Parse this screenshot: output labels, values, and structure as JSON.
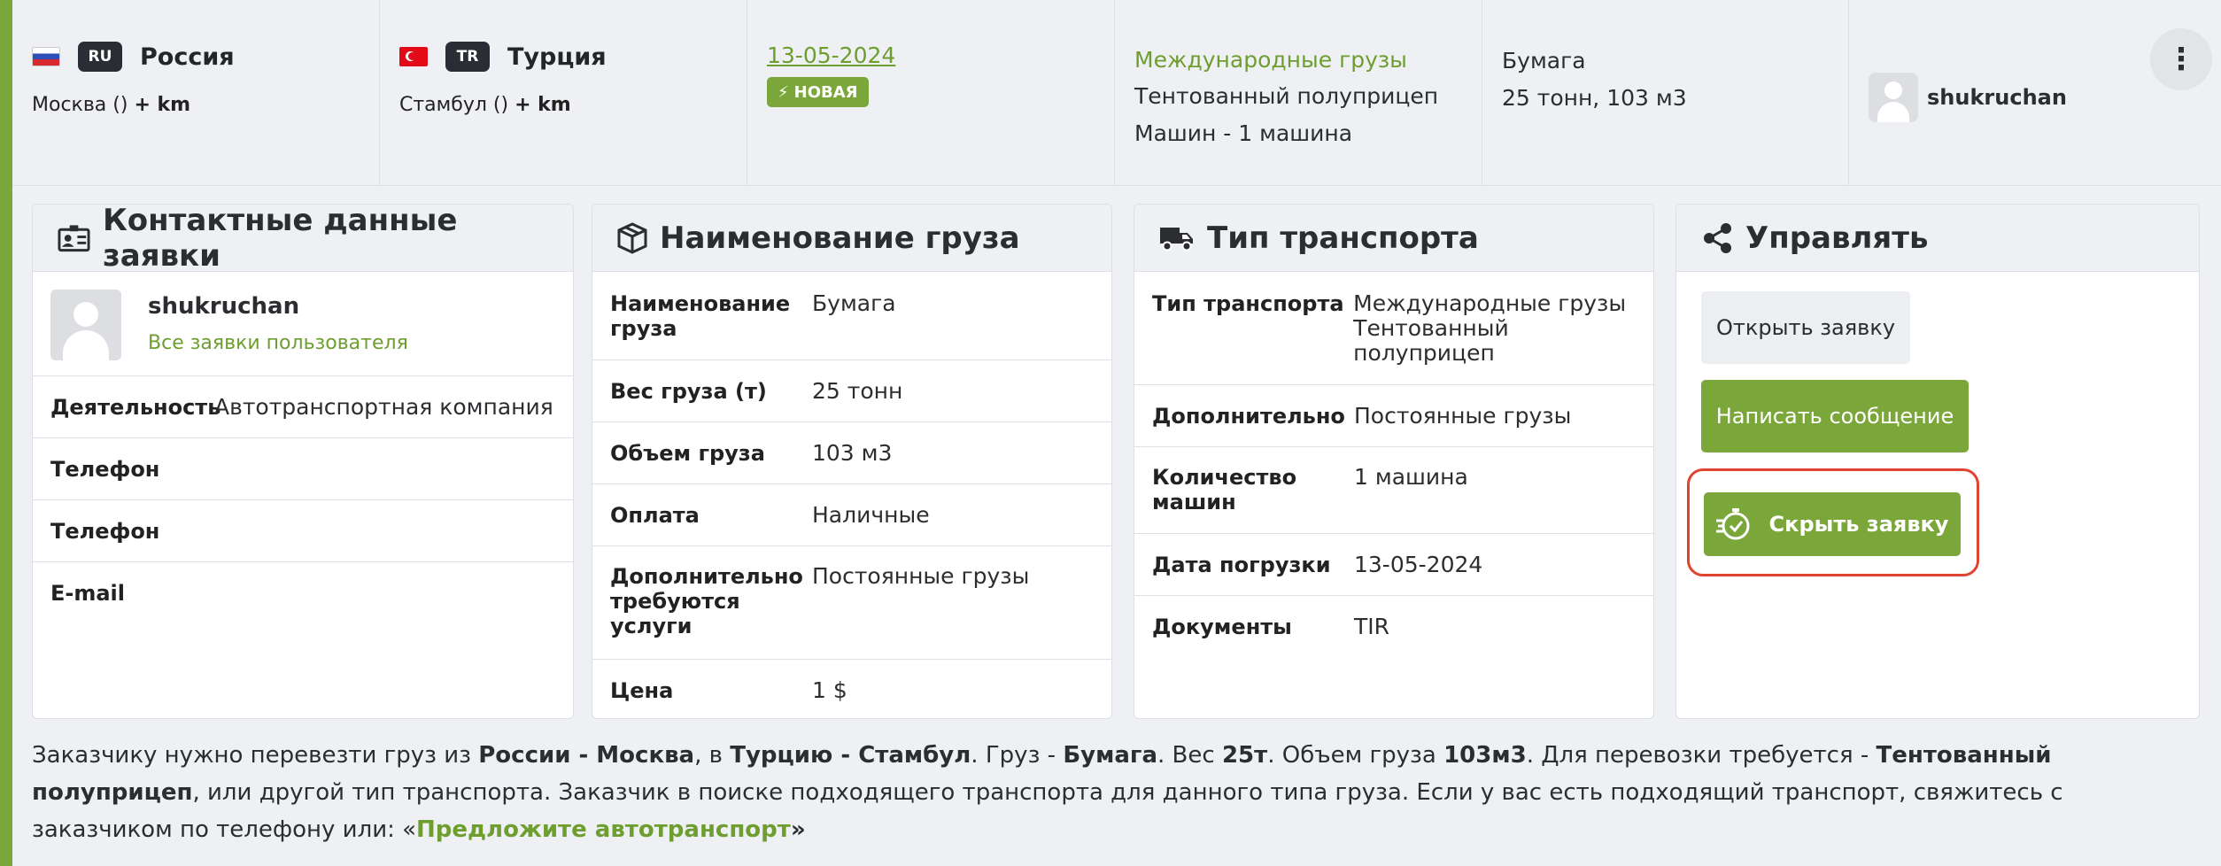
{
  "top": {
    "origin": {
      "code": "RU",
      "country": "Россия",
      "city": "Москва ()",
      "km": "+ km"
    },
    "destination": {
      "code": "TR",
      "country": "Турция",
      "city": "Стамбул ()",
      "km": "+ km"
    },
    "date": "13-05-2024",
    "new_badge": "НОВАЯ",
    "transport": {
      "category": "Международные грузы",
      "type": "Тентованный полуприцеп",
      "machines": "Машин - 1 машина"
    },
    "cargo": {
      "name": "Бумага",
      "weight_volume": "25 тонн, 103 м3"
    },
    "user": "shukruchan",
    "menu_icon": "⋮"
  },
  "contact_card": {
    "title": "Контактные данные заявки",
    "user_name": "shukruchan",
    "user_link": "Все заявки пользователя",
    "rows": [
      {
        "label": "Деятельность",
        "value": "Автотранспортная компания"
      },
      {
        "label": "Телефон",
        "value": ""
      },
      {
        "label": "Телефон",
        "value": ""
      },
      {
        "label": "E-mail",
        "value": ""
      }
    ]
  },
  "cargo_card": {
    "title": "Наименование груза",
    "rows": [
      {
        "label": "Наименование груза",
        "value": "Бумага"
      },
      {
        "label": "Вес груза (т)",
        "value": "25 тонн"
      },
      {
        "label": "Объем груза",
        "value": "103 м3"
      },
      {
        "label": "Оплата",
        "value": "Наличные"
      },
      {
        "label": "Дополнительно требуются услуги",
        "value": "Постоянные грузы"
      },
      {
        "label": "Цена",
        "value": "1 $"
      }
    ]
  },
  "transport_card": {
    "title": "Тип транспорта",
    "rows": [
      {
        "label": "Тип транспорта",
        "value": "Международные грузы Тентованный полуприцеп"
      },
      {
        "label": "Дополнительно",
        "value": "Постоянные грузы"
      },
      {
        "label": "Количество машин",
        "value": "1 машина"
      },
      {
        "label": "Дата погрузки",
        "value": "13-05-2024"
      },
      {
        "label": "Документы",
        "value": "TIR"
      }
    ]
  },
  "manage_card": {
    "title": "Управлять",
    "open_button": "Открыть заявку",
    "message_button": "Написать сообщение",
    "hide_button": "Скрыть заявку"
  },
  "description": {
    "p1": "Заказчику нужно перевезти груз из ",
    "from": "России - Москва",
    "p2": ", в ",
    "to": "Турцию - Стамбул",
    "p3": ". Груз - ",
    "cargo": "Бумага",
    "p4": ". Вес ",
    "weight": "25т",
    "p5": ". Объем груза ",
    "volume": "103м3",
    "p6": ". Для перевозки требуется - ",
    "transport": "Тентованный полуприцеп",
    "p7": ", или другой тип транспорта. Заказчик в поиске подходящего транспорта для данного типа груза. Если у вас есть подходящий транспорт, свяжитесь с заказчиком по телефону или: «",
    "link": "Предложите автотранспорт",
    "p8": "»"
  },
  "colors": {
    "accent": "#7ba73a",
    "highlight": "#e0432f"
  }
}
